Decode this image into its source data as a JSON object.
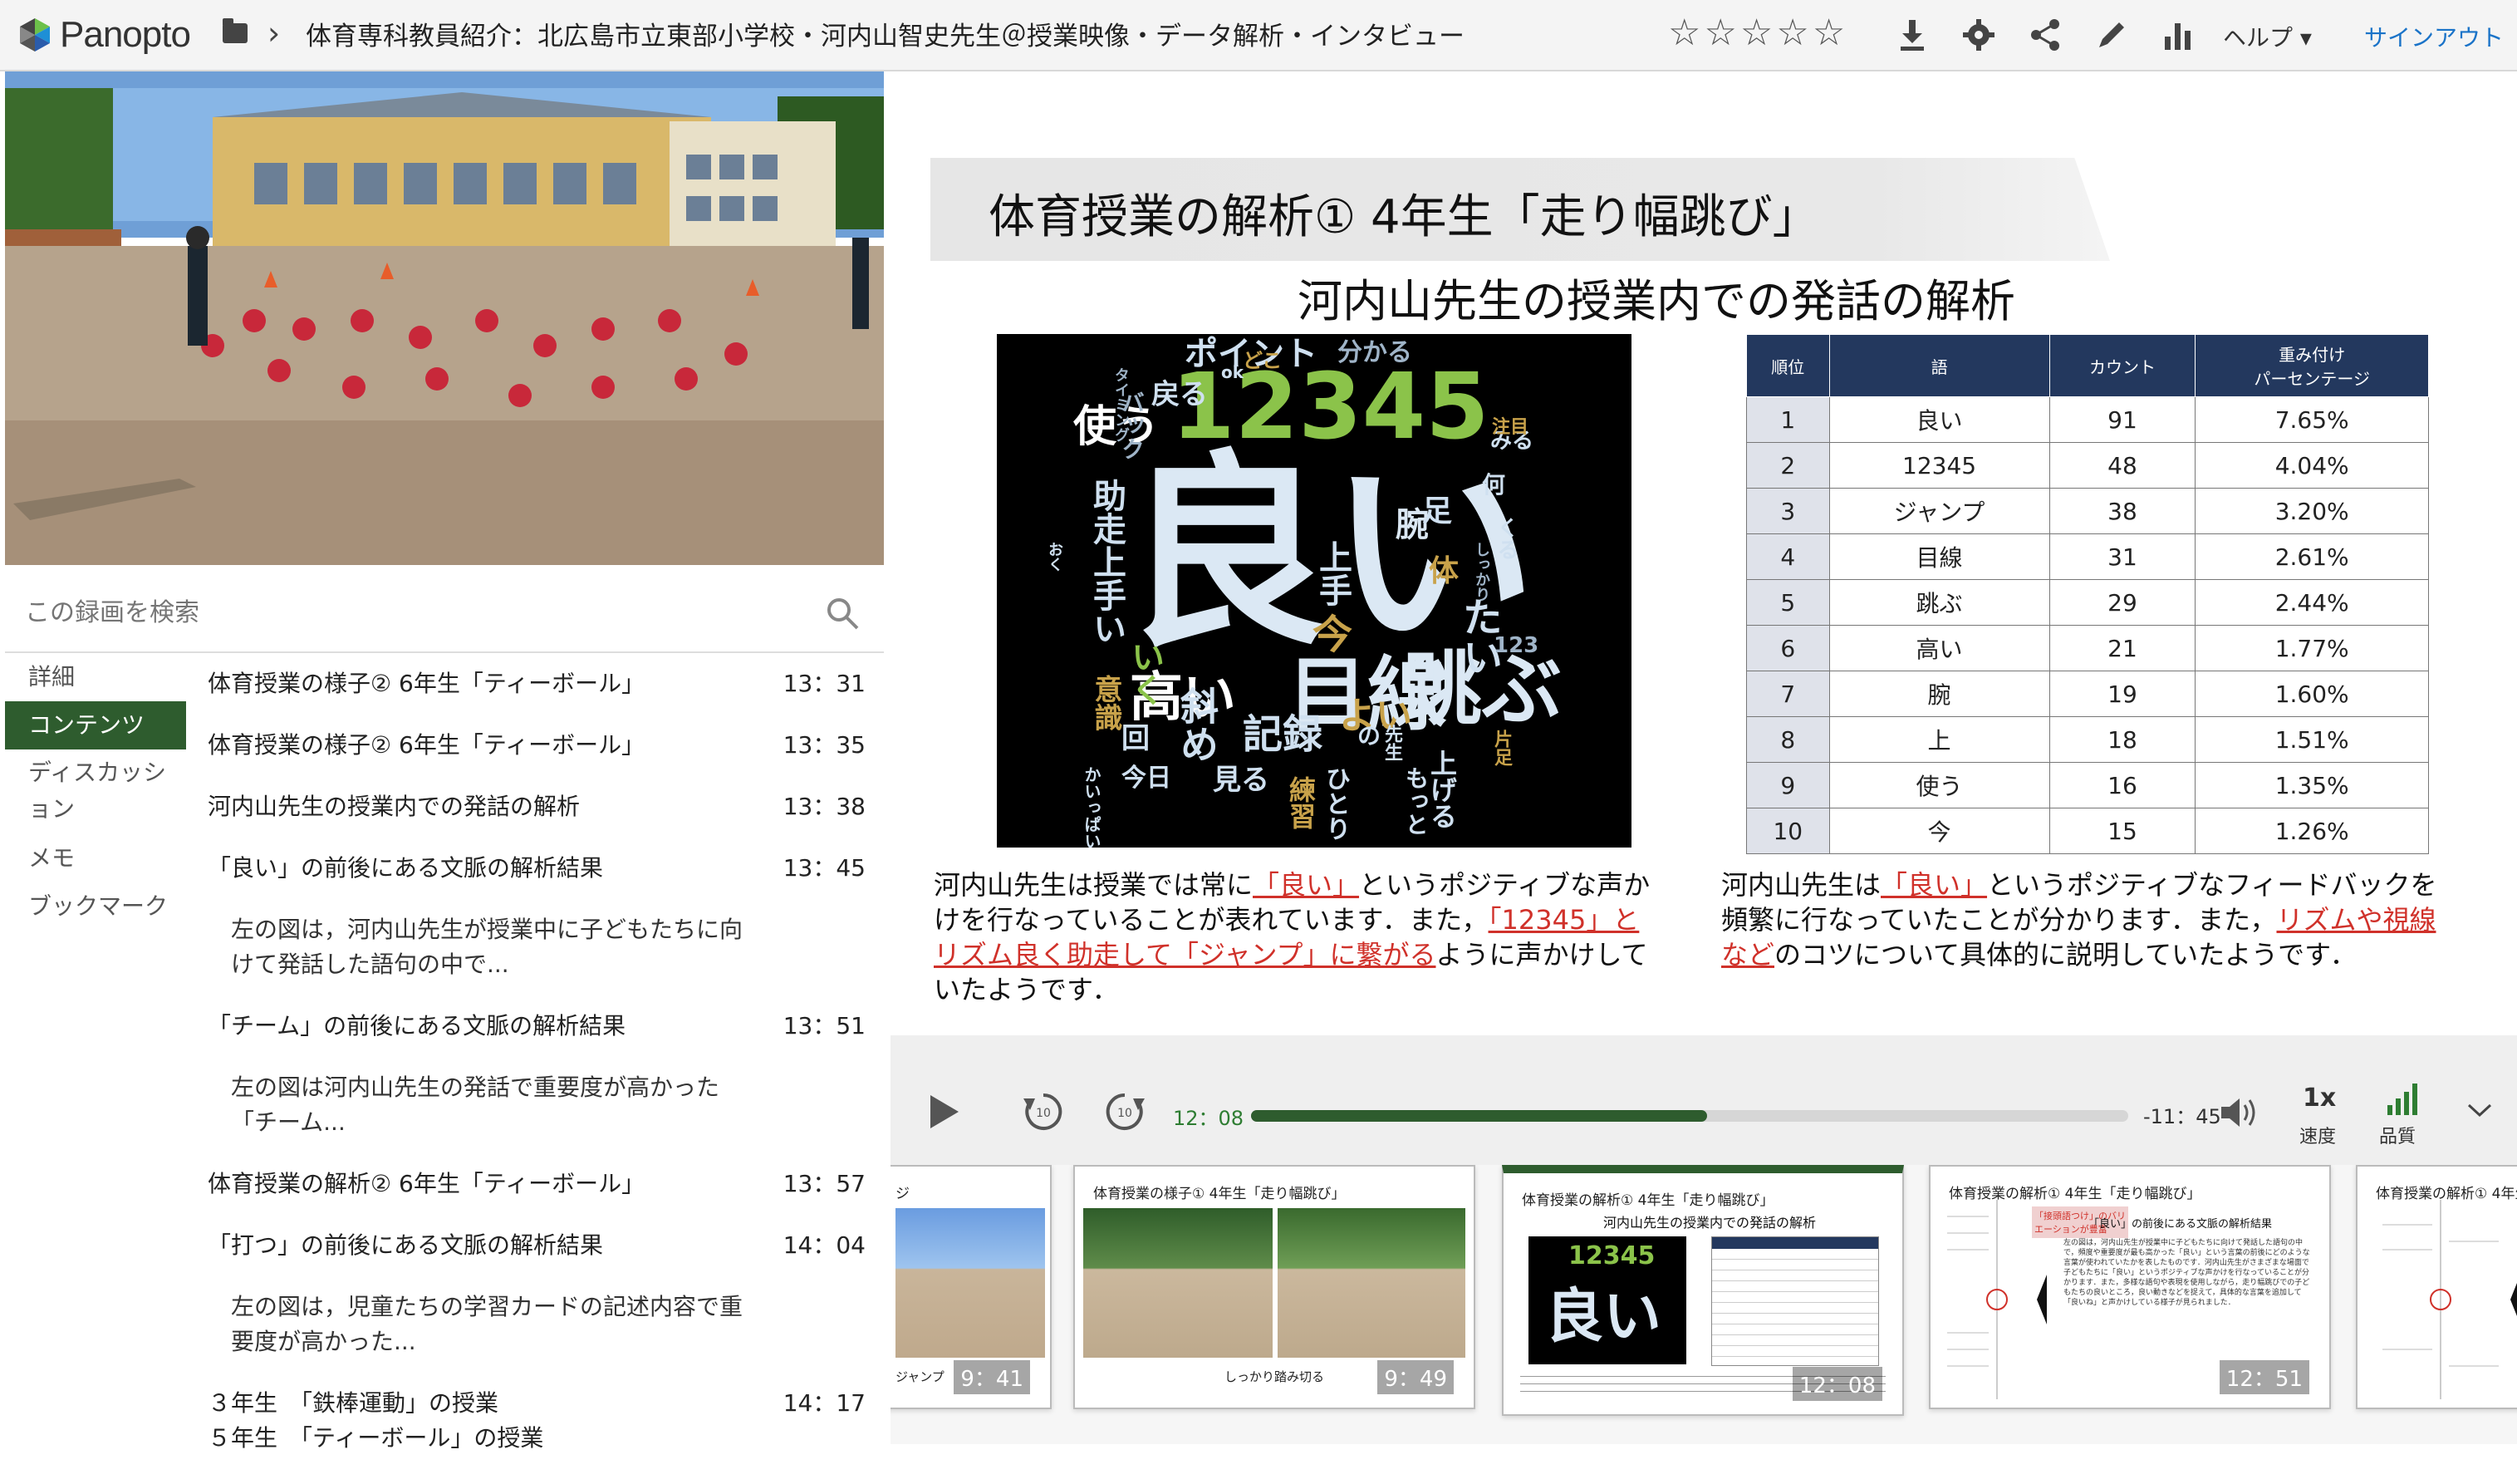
{
  "app": {
    "logo_text": "Panopto"
  },
  "header": {
    "title": "体育専科教員紹介：北広島市立東部小学校・河内山智史先生＠授業映像・データ解析・インタビュー",
    "rating_stars": [
      "☆",
      "☆",
      "☆",
      "☆",
      "☆"
    ],
    "help_label": "ヘルプ ▾",
    "signout_label": "サインアウト",
    "icons": [
      "download-icon",
      "gear-icon",
      "share-icon",
      "pencil-icon",
      "stats-icon"
    ]
  },
  "search": {
    "placeholder": "この録画を検索"
  },
  "left_tabs": [
    {
      "label": "詳細",
      "active": false
    },
    {
      "label": "コンテンツ",
      "active": true
    },
    {
      "label": "ディスカッション",
      "active": false
    },
    {
      "label": "メモ",
      "active": false
    },
    {
      "label": "ブックマーク",
      "active": false
    }
  ],
  "contents": [
    {
      "title": "体育授業の様子② 6年生「ティーボール」",
      "time": "13：31"
    },
    {
      "title": "体育授業の様子② 6年生「ティーボール」",
      "time": "13：35"
    },
    {
      "title": "河内山先生の授業内での発話の解析",
      "time": "13：38"
    },
    {
      "title": "「良い」の前後にある文脈の解析結果",
      "time": "13：45"
    },
    {
      "title": "左の図は，河内山先生が授業中に子どもたちに向けて発話した語句の中で...",
      "time": ""
    },
    {
      "title": "「チーム」の前後にある文脈の解析結果",
      "time": "13：51"
    },
    {
      "title": "左の図は河内山先生の発話で重要度が高かった「チーム...",
      "time": ""
    },
    {
      "title": "体育授業の解析② 6年生「ティーボール」",
      "time": "13：57"
    },
    {
      "title": "「打つ」の前後にある文脈の解析結果",
      "time": "14：04"
    },
    {
      "title": "左の図は，児童たちの学習カードの記述内容で重要度が高かった...",
      "time": ""
    },
    {
      "title": "３年生　「鉄棒運動」の授業\n５年生　「ティーボール」の授業",
      "time": "14：17"
    }
  ],
  "slide": {
    "title": "体育授業の解析① 4年生「走り幅跳び」",
    "subtitle": "河内山先生の授業内での発話の解析",
    "table": {
      "headers": [
        "順位",
        "語",
        "カウント",
        "重み付け\nパーセンテージ"
      ],
      "rows": [
        [
          "1",
          "良い",
          "91",
          "7.65%"
        ],
        [
          "2",
          "12345",
          "48",
          "4.04%"
        ],
        [
          "3",
          "ジャンプ",
          "38",
          "3.20%"
        ],
        [
          "4",
          "目線",
          "31",
          "2.61%"
        ],
        [
          "5",
          "跳ぶ",
          "29",
          "2.44%"
        ],
        [
          "6",
          "高い",
          "21",
          "1.77%"
        ],
        [
          "7",
          "腕",
          "19",
          "1.60%"
        ],
        [
          "8",
          "上",
          "18",
          "1.51%"
        ],
        [
          "9",
          "使う",
          "16",
          "1.35%"
        ],
        [
          "10",
          "今",
          "15",
          "1.26%"
        ]
      ]
    },
    "caption_left": {
      "p1": "河内山先生は授業では常に",
      "h1": "「良い」",
      "p2": "というポジティブな声かけを行なっていることが表れています．また，",
      "h2": "「12345」とリズム良く助走して「ジャンプ」に繋がる",
      "p3": "ように声かけしていたようです．"
    },
    "caption_right": {
      "p1": "河内山先生は",
      "h1": "「良い」",
      "p2": "というポジティブなフィードバックを頻繁に行なっていたことが分かります．また，",
      "h2": "リズムや視線など",
      "p3": "のコツについて具体的に説明していたようです．"
    },
    "wordcloud": [
      {
        "text": "良い",
        "color": "#dbe8f4"
      },
      {
        "text": "12345",
        "color": "#8bc34a"
      },
      {
        "text": "目線",
        "color": "#dbe8f4"
      },
      {
        "text": "跳ぶ",
        "color": "#dbe8f4"
      },
      {
        "text": "高い",
        "color": "#ffffff"
      },
      {
        "text": "使う",
        "color": "#ffffff"
      },
      {
        "text": "ポイント",
        "color": "#cfe0f0"
      },
      {
        "text": "分かる",
        "color": "#9fb4c8"
      },
      {
        "text": "戻る",
        "color": "#cfe0f0"
      },
      {
        "text": "助走上手い",
        "color": "#cfe0f0"
      },
      {
        "text": "記録",
        "color": "#cfe0f0"
      },
      {
        "text": "よい",
        "color": "#c8a24a"
      },
      {
        "text": "上げる",
        "color": "#cfe0f0"
      },
      {
        "text": "たい",
        "color": "#cfe0f0"
      },
      {
        "text": "今",
        "color": "#c8a24a"
      },
      {
        "text": "みる",
        "color": "#cfe0f0"
      },
      {
        "text": "くる",
        "color": "#cfe0f0"
      },
      {
        "text": "何",
        "color": "#cfe0f0"
      },
      {
        "text": "123",
        "color": "#9fb4c8"
      },
      {
        "text": "上手",
        "color": "#cfe0f0"
      },
      {
        "text": "見る",
        "color": "#cfe0f0"
      },
      {
        "text": "練習",
        "color": "#c8a24a"
      },
      {
        "text": "意識",
        "color": "#c8a24a"
      },
      {
        "text": "回",
        "color": "#cfe0f0"
      },
      {
        "text": "いく",
        "color": "#8bc34a"
      },
      {
        "text": "片足",
        "color": "#c8a24a"
      },
      {
        "text": "腕",
        "color": "#dbe8f4"
      },
      {
        "text": "体",
        "color": "#c8a24a"
      },
      {
        "text": "どこ",
        "color": "#c8a24a"
      },
      {
        "text": "ok",
        "color": "#cfe0f0"
      },
      {
        "text": "タイミング",
        "color": "#9fb4c8"
      },
      {
        "text": "バック",
        "color": "#9fb4c8"
      },
      {
        "text": "注目",
        "color": "#c8a24a"
      },
      {
        "text": "足",
        "color": "#cfe0f0"
      },
      {
        "text": "かいっぱい",
        "color": "#cfe0f0"
      },
      {
        "text": "今日",
        "color": "#cfe0f0"
      },
      {
        "text": "しっかり",
        "color": "#9fb4c8"
      },
      {
        "text": "おく",
        "color": "#cfe0f0"
      },
      {
        "text": "斜め",
        "color": "#cfe0f0"
      },
      {
        "text": "ひとり",
        "color": "#cfe0f0"
      },
      {
        "text": "の",
        "color": "#cfe0f0"
      },
      {
        "text": "先生",
        "color": "#cfe0f0"
      },
      {
        "text": "もっと",
        "color": "#cfe0f0"
      }
    ]
  },
  "player": {
    "current_time": "12：08",
    "remaining_time": "-11：45",
    "progress_fraction": 0.52,
    "speed_value": "1x",
    "speed_label": "速度",
    "quality_label": "品質"
  },
  "thumbnails": [
    {
      "title": "ジ",
      "time": "9：41",
      "caption": "ジャンプ",
      "active": false
    },
    {
      "title": "体育授業の様子① 4年生「走り幅跳び」",
      "time": "9：49",
      "caption": "しっかり踏み切る",
      "active": false
    },
    {
      "title": "体育授業の解析① 4年生「走り幅跳び」",
      "time": "12：08",
      "caption": "",
      "active": true
    },
    {
      "title": "体育授業の解析① 4年生「走り幅跳び」",
      "time": "12：51",
      "caption": "",
      "active": false
    },
    {
      "title": "体育授業の解析① 4年生「走",
      "time": "",
      "caption": "",
      "active": false
    }
  ],
  "thumb3": {
    "subtitle": "河内山先生の授業内での発話の解析",
    "wc_big": "良い",
    "wc_num": "12345"
  },
  "thumb4": {
    "callout": "「接頭語つけ」のバリエーションが豊富",
    "subtitle": "「良い」の前後にある文脈の解析結果",
    "body": "左の図は，河内山先生が授業中に子どもたちに向けて発話した語句の中で，頻度や重要度が最も高かった「良い」という言葉の前後にどのような言葉が使われていたかを表したものです．河内山先生がさまざまな場面で子どもたちに「良い」というポジティブな声かけを行なっていることが分かります．また，多様な語句や表現を使用しながら，走り幅跳びでの子どもたちの良いところ，良い動きなどを捉えて，具体的な言葉を追加して「良いね」と声かけしている様子が見られました．"
  },
  "colors": {
    "accent": "#2e5c2e",
    "link": "#1a73c8",
    "highlight": "#d0312a",
    "table_header": "#23385e"
  }
}
